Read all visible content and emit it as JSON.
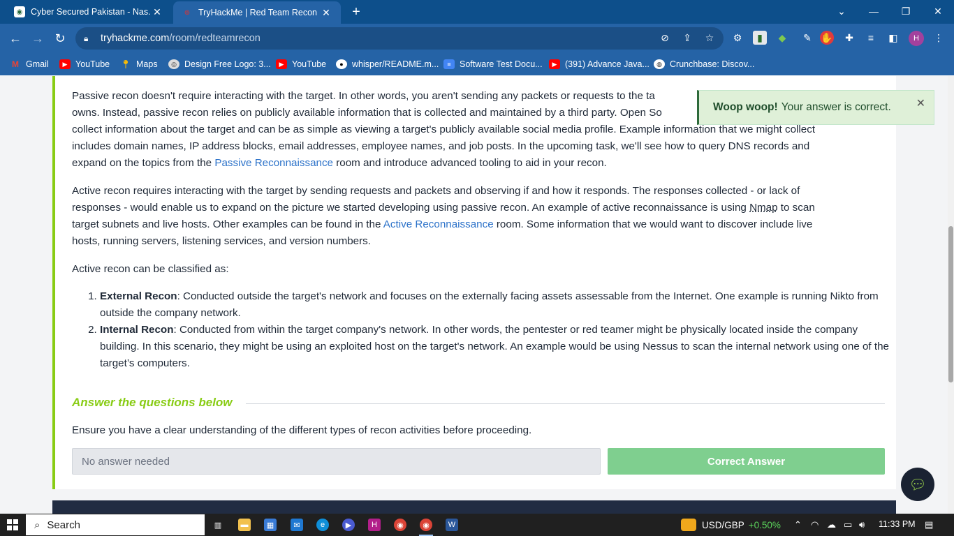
{
  "browser": {
    "tabs": [
      {
        "title": "Cyber Secured Pakistan - Nas.io",
        "active": false
      },
      {
        "title": "TryHackMe | Red Team Recon",
        "active": true
      }
    ],
    "url_host": "tryhackme.com",
    "url_path": "/room/redteamrecon",
    "profile_initial": "H",
    "bookmarks": [
      {
        "label": "Gmail",
        "icon": "gmail-icon"
      },
      {
        "label": "YouTube",
        "icon": "youtube-icon"
      },
      {
        "label": "Maps",
        "icon": "maps-icon"
      },
      {
        "label": "Design Free Logo: 3...",
        "icon": "logo-site-icon"
      },
      {
        "label": "YouTube",
        "icon": "youtube-icon"
      },
      {
        "label": "whisper/README.m...",
        "icon": "github-icon"
      },
      {
        "label": "Software Test Docu...",
        "icon": "docs-icon"
      },
      {
        "label": "(391) Advance Java...",
        "icon": "youtube-icon"
      },
      {
        "label": "Crunchbase: Discov...",
        "icon": "globe-icon"
      }
    ]
  },
  "content": {
    "para1_a": "Passive recon doesn't require interacting with the target. In other words, you aren't sending any packets or requests to the ta",
    "para1_b": "owns. Instead, passive recon relies on publicly available information that is collected and maintained by a third party. Open So",
    "para1_c": "collect information about the target and can be as simple as viewing a target's publicly available social media profile. Example information that we might collect",
    "para1_d": "includes domain names, IP address blocks, email addresses, employee names, and job posts. In the upcoming task, we'll see how to query DNS records and",
    "para1_e_pre": "expand on the topics from the ",
    "para1_e_link": "Passive Reconnaissance",
    "para1_e_post": " room and introduce advanced tooling to aid in your recon.",
    "para2_a_pre": "Active recon requires interacting with the target by sending requests and packets and observing if and how it responds. The responses collected - or lack of",
    "para2_b_pre": "responses - would enable us to expand on the picture we started developing using passive recon. An example of active reconnaissance is using ",
    "para2_b_nmap": "Nmap",
    "para2_b_post": " to scan",
    "para2_c_pre": "target subnets and live hosts. Other examples can be found in the ",
    "para2_c_link": "Active Reconnaissance",
    "para2_c_post": " room. Some information that we would want to discover include live",
    "para2_d": "hosts, running servers, listening services, and version numbers.",
    "para3": "Active recon can be classified as:",
    "list": [
      {
        "title": "External Recon",
        "text": ": Conducted outside the target's network and focuses on the externally facing assets assessable from the Internet. One example is running Nikto from outside the company network."
      },
      {
        "title": "Internal Recon",
        "text": ": Conducted from within the target company's network. In other words, the pentester or red teamer might be physically located inside the company building. In this scenario, they might be using an exploited host on the target's network. An example would be using Nessus to scan the internal network using one of the target’s computers."
      }
    ],
    "answer_heading": "Answer the questions below",
    "question": "Ensure you have a clear understanding of the different types of recon activities before proceeding.",
    "answer_placeholder": "No answer needed",
    "correct_label": "Correct Answer"
  },
  "toast": {
    "bold": "Woop woop!",
    "text": "Your answer is correct."
  },
  "taskbar": {
    "search_label": "Search",
    "stock_pair": "USD/GBP",
    "stock_change": "+0.50%",
    "time": "11:33 PM"
  },
  "colors": {
    "accent_green": "#88cc14",
    "link_blue": "#2c72c9",
    "chrome_blue": "#2563a6"
  }
}
